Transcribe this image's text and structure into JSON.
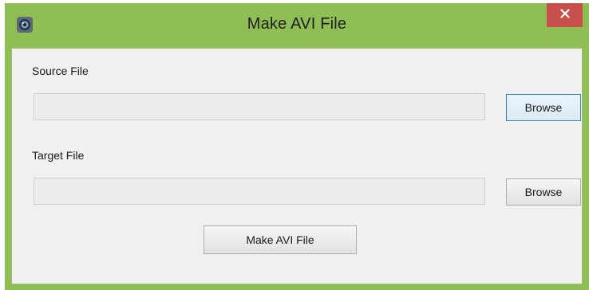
{
  "window": {
    "title": "Make AVI File",
    "app_icon": "webcam-icon",
    "close_icon": "close-x-icon",
    "frame_color": "#8fbe55",
    "close_color": "#c7504b"
  },
  "source": {
    "label": "Source File",
    "value": "",
    "browse_label": "Browse"
  },
  "target": {
    "label": "Target File",
    "value": "",
    "browse_label": "Browse"
  },
  "actions": {
    "make_label": "Make AVI File"
  }
}
